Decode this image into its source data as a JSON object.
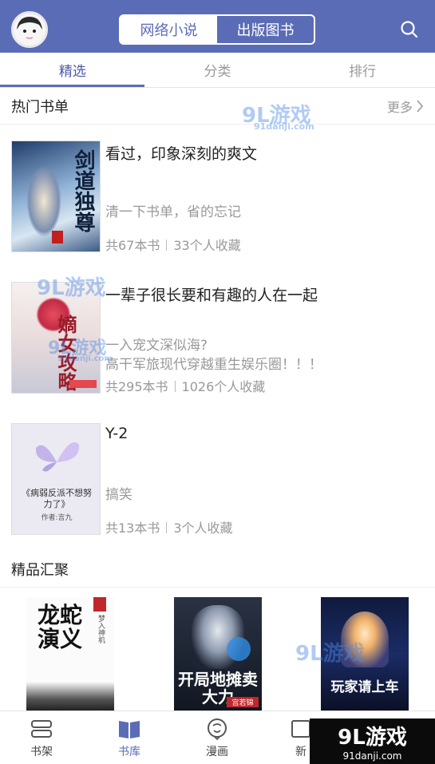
{
  "header": {
    "seg_left": "网络小说",
    "seg_right": "出版图书"
  },
  "tabs": [
    {
      "label": "精选"
    },
    {
      "label": "分类"
    },
    {
      "label": "排行"
    }
  ],
  "hot": {
    "title": "热门书单",
    "more": "更多",
    "items": [
      {
        "title": "看过，印象深刻的爽文",
        "desc": [
          "清一下书单，省的忘记"
        ],
        "count": "共67本书",
        "favs": "33个人收藏",
        "cover_text": "剑道独尊"
      },
      {
        "title": "一辈子很长要和有趣的人在一起",
        "desc": [
          "一入宠文深似海?",
          "高干军旅现代穿越重生娱乐圈！！！"
        ],
        "count": "共295本书",
        "favs": "1026个人收藏",
        "cover_text": "嫡女攻略"
      },
      {
        "title": "Y-2",
        "desc": [
          "搞笑"
        ],
        "count": "共13本书",
        "favs": "3个人收藏",
        "cover_text": "《病弱反派不想努力了》",
        "cover_author": "作者:言九"
      }
    ]
  },
  "featured": {
    "title": "精品汇聚",
    "covers": [
      {
        "title": "龙蛇演义",
        "author": "梦入神机"
      },
      {
        "title": "开局地摊卖大力",
        "author": "宫若锦"
      },
      {
        "title": "玩家请上车",
        "author": ""
      }
    ]
  },
  "tabbar": [
    {
      "label": "书架"
    },
    {
      "label": "书库"
    },
    {
      "label": "漫画"
    },
    {
      "label": "新"
    }
  ],
  "watermark": {
    "big": "9L游戏",
    "small": "91danji.com",
    "overlay": "9L游戏",
    "overlay_small": "91danji.com"
  },
  "colors": {
    "brand": "#5b6cb6"
  }
}
